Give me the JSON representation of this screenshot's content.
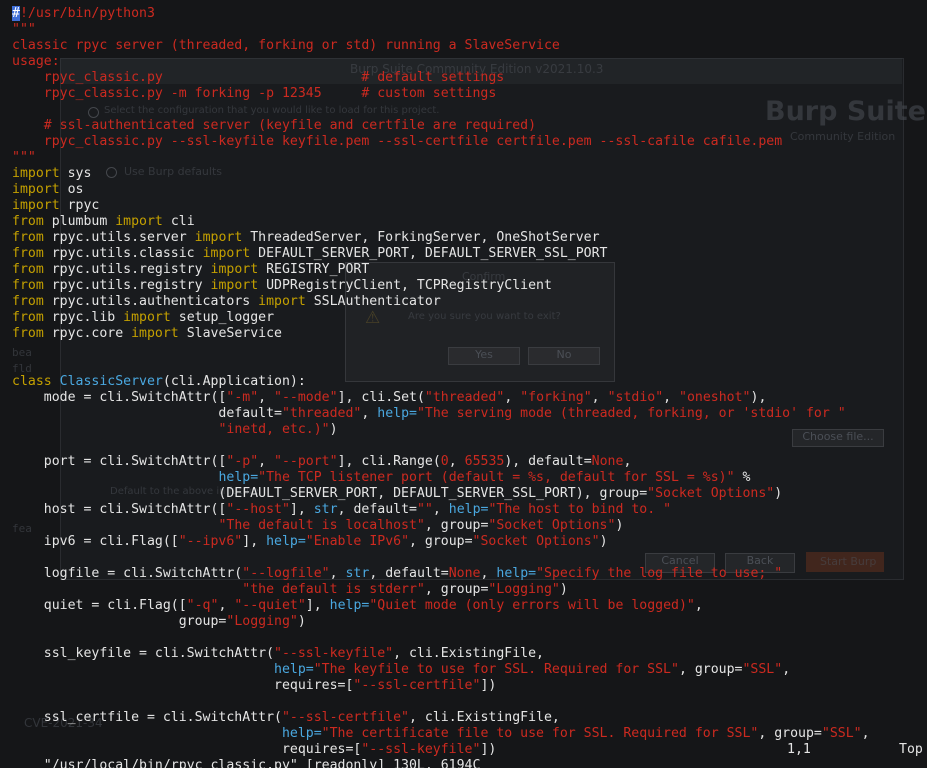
{
  "background_artifacts": {
    "window_title": "Burp Suite Community Edition v2021.10.3",
    "brand": "Burp Suite",
    "brand_sub": "Community Edition",
    "option1": "Select the configuration that you would like to load for this project.",
    "option2": "Use Burp defaults",
    "dialog_title": "Confirm",
    "dialog_message": "Are you sure you want to exit?",
    "yes": "Yes",
    "no": "No",
    "choose_file": "Choose file...",
    "default_to_above": "Default to the above in future",
    "cancel": "Cancel",
    "back": "Back",
    "start_burp": "Start Burp",
    "desktop_label": "CVE-2021-34",
    "sidebar_frag1": "bea",
    "sidebar_frag2": "fld",
    "sidebar_frag3": "fea"
  },
  "editor": {
    "lines": [
      [
        {
          "t": "#",
          "c": "cursor"
        },
        {
          "t": "!/usr/bin/python3",
          "c": "doc"
        }
      ],
      [
        {
          "t": "\"\"\"",
          "c": "doc"
        }
      ],
      [
        {
          "t": "classic rpyc server (threaded, forking or std) running a SlaveService",
          "c": "doc"
        }
      ],
      [
        {
          "t": "usage:",
          "c": "doc"
        }
      ],
      [
        {
          "t": "    rpyc_classic.py                         # default settings",
          "c": "doc"
        }
      ],
      [
        {
          "t": "    rpyc_classic.py -m forking -p 12345     # custom settings",
          "c": "doc"
        }
      ],
      [
        {
          "t": "",
          "c": "ident"
        }
      ],
      [
        {
          "t": "    # ssl-authenticated server (keyfile and certfile are required)",
          "c": "doc"
        }
      ],
      [
        {
          "t": "    rpyc_classic.py --ssl-keyfile keyfile.pem --ssl-certfile certfile.pem --ssl-cafile cafile.pem",
          "c": "doc"
        }
      ],
      [
        {
          "t": "\"\"\"",
          "c": "doc"
        }
      ],
      [
        {
          "t": "import",
          "c": "kw"
        },
        {
          "t": " sys",
          "c": "ident"
        }
      ],
      [
        {
          "t": "import",
          "c": "kw"
        },
        {
          "t": " os",
          "c": "ident"
        }
      ],
      [
        {
          "t": "import",
          "c": "kw"
        },
        {
          "t": " rpyc",
          "c": "ident"
        }
      ],
      [
        {
          "t": "from",
          "c": "kw"
        },
        {
          "t": " plumbum ",
          "c": "ident"
        },
        {
          "t": "import",
          "c": "kw"
        },
        {
          "t": " cli",
          "c": "ident"
        }
      ],
      [
        {
          "t": "from",
          "c": "kw"
        },
        {
          "t": " rpyc.utils.server ",
          "c": "ident"
        },
        {
          "t": "import",
          "c": "kw"
        },
        {
          "t": " ThreadedServer, ForkingServer, OneShotServer",
          "c": "ident"
        }
      ],
      [
        {
          "t": "from",
          "c": "kw"
        },
        {
          "t": " rpyc.utils.classic ",
          "c": "ident"
        },
        {
          "t": "import",
          "c": "kw"
        },
        {
          "t": " DEFAULT_SERVER_PORT, DEFAULT_SERVER_SSL_PORT",
          "c": "ident"
        }
      ],
      [
        {
          "t": "from",
          "c": "kw"
        },
        {
          "t": " rpyc.utils.registry ",
          "c": "ident"
        },
        {
          "t": "import",
          "c": "kw"
        },
        {
          "t": " REGISTRY_PORT",
          "c": "ident"
        }
      ],
      [
        {
          "t": "from",
          "c": "kw"
        },
        {
          "t": " rpyc.utils.registry ",
          "c": "ident"
        },
        {
          "t": "import",
          "c": "kw"
        },
        {
          "t": " UDPRegistryClient, TCPRegistryClient",
          "c": "ident"
        }
      ],
      [
        {
          "t": "from",
          "c": "kw"
        },
        {
          "t": " rpyc.utils.authenticators ",
          "c": "ident"
        },
        {
          "t": "import",
          "c": "kw"
        },
        {
          "t": " SSLAuthenticator",
          "c": "ident"
        }
      ],
      [
        {
          "t": "from",
          "c": "kw"
        },
        {
          "t": " rpyc.lib ",
          "c": "ident"
        },
        {
          "t": "import",
          "c": "kw"
        },
        {
          "t": " setup_logger",
          "c": "ident"
        }
      ],
      [
        {
          "t": "from",
          "c": "kw"
        },
        {
          "t": " rpyc.core ",
          "c": "ident"
        },
        {
          "t": "import",
          "c": "kw"
        },
        {
          "t": " SlaveService",
          "c": "ident"
        }
      ],
      [
        {
          "t": "",
          "c": "ident"
        }
      ],
      [
        {
          "t": "",
          "c": "ident"
        }
      ],
      [
        {
          "t": "class",
          "c": "kw"
        },
        {
          "t": " ",
          "c": "ident"
        },
        {
          "t": "ClassicServer",
          "c": "cls"
        },
        {
          "t": "(cli.Application):",
          "c": "ident"
        }
      ],
      [
        {
          "t": "    mode = cli.SwitchAttr([",
          "c": "ident"
        },
        {
          "t": "\"-m\"",
          "c": "str"
        },
        {
          "t": ", ",
          "c": "ident"
        },
        {
          "t": "\"--mode\"",
          "c": "str"
        },
        {
          "t": "], cli.Set(",
          "c": "ident"
        },
        {
          "t": "\"threaded\"",
          "c": "str"
        },
        {
          "t": ", ",
          "c": "ident"
        },
        {
          "t": "\"forking\"",
          "c": "str"
        },
        {
          "t": ", ",
          "c": "ident"
        },
        {
          "t": "\"stdio\"",
          "c": "str"
        },
        {
          "t": ", ",
          "c": "ident"
        },
        {
          "t": "\"oneshot\"",
          "c": "str"
        },
        {
          "t": "),",
          "c": "ident"
        }
      ],
      [
        {
          "t": "                          default=",
          "c": "ident"
        },
        {
          "t": "\"threaded\"",
          "c": "str"
        },
        {
          "t": ", ",
          "c": "ident"
        },
        {
          "t": "help=",
          "c": "cls"
        },
        {
          "t": "\"The serving mode (threaded, forking, or 'stdio' for \"",
          "c": "str"
        }
      ],
      [
        {
          "t": "                          ",
          "c": "ident"
        },
        {
          "t": "\"inetd, etc.)\"",
          "c": "str"
        },
        {
          "t": ")",
          "c": "ident"
        }
      ],
      [
        {
          "t": "",
          "c": "ident"
        }
      ],
      [
        {
          "t": "    port = cli.SwitchAttr([",
          "c": "ident"
        },
        {
          "t": "\"-p\"",
          "c": "str"
        },
        {
          "t": ", ",
          "c": "ident"
        },
        {
          "t": "\"--port\"",
          "c": "str"
        },
        {
          "t": "], cli.Range(",
          "c": "ident"
        },
        {
          "t": "0",
          "c": "str"
        },
        {
          "t": ", ",
          "c": "ident"
        },
        {
          "t": "65535",
          "c": "str"
        },
        {
          "t": "), default=",
          "c": "ident"
        },
        {
          "t": "None",
          "c": "str"
        },
        {
          "t": ",",
          "c": "ident"
        }
      ],
      [
        {
          "t": "                          ",
          "c": "ident"
        },
        {
          "t": "help=",
          "c": "cls"
        },
        {
          "t": "\"The TCP listener port (default = %s, default for SSL = %s)\"",
          "c": "str"
        },
        {
          "t": " %",
          "c": "ident"
        }
      ],
      [
        {
          "t": "                          (DEFAULT_SERVER_PORT, DEFAULT_SERVER_SSL_PORT), group=",
          "c": "ident"
        },
        {
          "t": "\"Socket Options\"",
          "c": "str"
        },
        {
          "t": ")",
          "c": "ident"
        }
      ],
      [
        {
          "t": "    host = cli.SwitchAttr([",
          "c": "ident"
        },
        {
          "t": "\"--host\"",
          "c": "str"
        },
        {
          "t": "], ",
          "c": "ident"
        },
        {
          "t": "str",
          "c": "cls"
        },
        {
          "t": ", default=",
          "c": "ident"
        },
        {
          "t": "\"\"",
          "c": "str"
        },
        {
          "t": ", ",
          "c": "ident"
        },
        {
          "t": "help=",
          "c": "cls"
        },
        {
          "t": "\"The host to bind to. \"",
          "c": "str"
        }
      ],
      [
        {
          "t": "                          ",
          "c": "ident"
        },
        {
          "t": "\"The default is localhost\"",
          "c": "str"
        },
        {
          "t": ", group=",
          "c": "ident"
        },
        {
          "t": "\"Socket Options\"",
          "c": "str"
        },
        {
          "t": ")",
          "c": "ident"
        }
      ],
      [
        {
          "t": "    ipv6 = cli.Flag([",
          "c": "ident"
        },
        {
          "t": "\"--ipv6\"",
          "c": "str"
        },
        {
          "t": "], ",
          "c": "ident"
        },
        {
          "t": "help=",
          "c": "cls"
        },
        {
          "t": "\"Enable IPv6\"",
          "c": "str"
        },
        {
          "t": ", group=",
          "c": "ident"
        },
        {
          "t": "\"Socket Options\"",
          "c": "str"
        },
        {
          "t": ")",
          "c": "ident"
        }
      ],
      [
        {
          "t": "",
          "c": "ident"
        }
      ],
      [
        {
          "t": "    logfile = cli.SwitchAttr(",
          "c": "ident"
        },
        {
          "t": "\"--logfile\"",
          "c": "str"
        },
        {
          "t": ", ",
          "c": "ident"
        },
        {
          "t": "str",
          "c": "cls"
        },
        {
          "t": ", default=",
          "c": "ident"
        },
        {
          "t": "None",
          "c": "str"
        },
        {
          "t": ", ",
          "c": "ident"
        },
        {
          "t": "help=",
          "c": "cls"
        },
        {
          "t": "\"Specify the log file to use; \"",
          "c": "str"
        }
      ],
      [
        {
          "t": "                             ",
          "c": "ident"
        },
        {
          "t": "\"the default is stderr\"",
          "c": "str"
        },
        {
          "t": ", group=",
          "c": "ident"
        },
        {
          "t": "\"Logging\"",
          "c": "str"
        },
        {
          "t": ")",
          "c": "ident"
        }
      ],
      [
        {
          "t": "    quiet = cli.Flag([",
          "c": "ident"
        },
        {
          "t": "\"-q\"",
          "c": "str"
        },
        {
          "t": ", ",
          "c": "ident"
        },
        {
          "t": "\"--quiet\"",
          "c": "str"
        },
        {
          "t": "], ",
          "c": "ident"
        },
        {
          "t": "help=",
          "c": "cls"
        },
        {
          "t": "\"Quiet mode (only errors will be logged)\"",
          "c": "str"
        },
        {
          "t": ",",
          "c": "ident"
        }
      ],
      [
        {
          "t": "                     group=",
          "c": "ident"
        },
        {
          "t": "\"Logging\"",
          "c": "str"
        },
        {
          "t": ")",
          "c": "ident"
        }
      ],
      [
        {
          "t": "",
          "c": "ident"
        }
      ],
      [
        {
          "t": "    ssl_keyfile = cli.SwitchAttr(",
          "c": "ident"
        },
        {
          "t": "\"--ssl-keyfile\"",
          "c": "str"
        },
        {
          "t": ", cli.ExistingFile,",
          "c": "ident"
        }
      ],
      [
        {
          "t": "                                 ",
          "c": "ident"
        },
        {
          "t": "help=",
          "c": "cls"
        },
        {
          "t": "\"The keyfile to use for SSL. Required for SSL\"",
          "c": "str"
        },
        {
          "t": ", group=",
          "c": "ident"
        },
        {
          "t": "\"SSL\"",
          "c": "str"
        },
        {
          "t": ",",
          "c": "ident"
        }
      ],
      [
        {
          "t": "                                 requires=[",
          "c": "ident"
        },
        {
          "t": "\"--ssl-certfile\"",
          "c": "str"
        },
        {
          "t": "])",
          "c": "ident"
        }
      ],
      [
        {
          "t": "",
          "c": "ident"
        }
      ],
      [
        {
          "t": "    ssl_certfile = cli.SwitchAttr(",
          "c": "ident"
        },
        {
          "t": "\"--ssl-certfile\"",
          "c": "str"
        },
        {
          "t": ", cli.ExistingFile,",
          "c": "ident"
        }
      ],
      [
        {
          "t": "                                  ",
          "c": "ident"
        },
        {
          "t": "help=",
          "c": "cls"
        },
        {
          "t": "\"The certificate file to use for SSL. Required for SSL\"",
          "c": "str"
        },
        {
          "t": ", group=",
          "c": "ident"
        },
        {
          "t": "\"SSL\"",
          "c": "str"
        },
        {
          "t": ",",
          "c": "ident"
        }
      ],
      [
        {
          "t": "                                  requires=[",
          "c": "ident"
        },
        {
          "t": "\"--ssl-keyfile\"",
          "c": "str"
        },
        {
          "t": "])",
          "c": "ident"
        }
      ]
    ]
  },
  "status": {
    "file": "\"/usr/local/bin/rpyc_classic.py\" [readonly] 130L, 6194C",
    "position": "1,1",
    "scroll": "Top"
  }
}
